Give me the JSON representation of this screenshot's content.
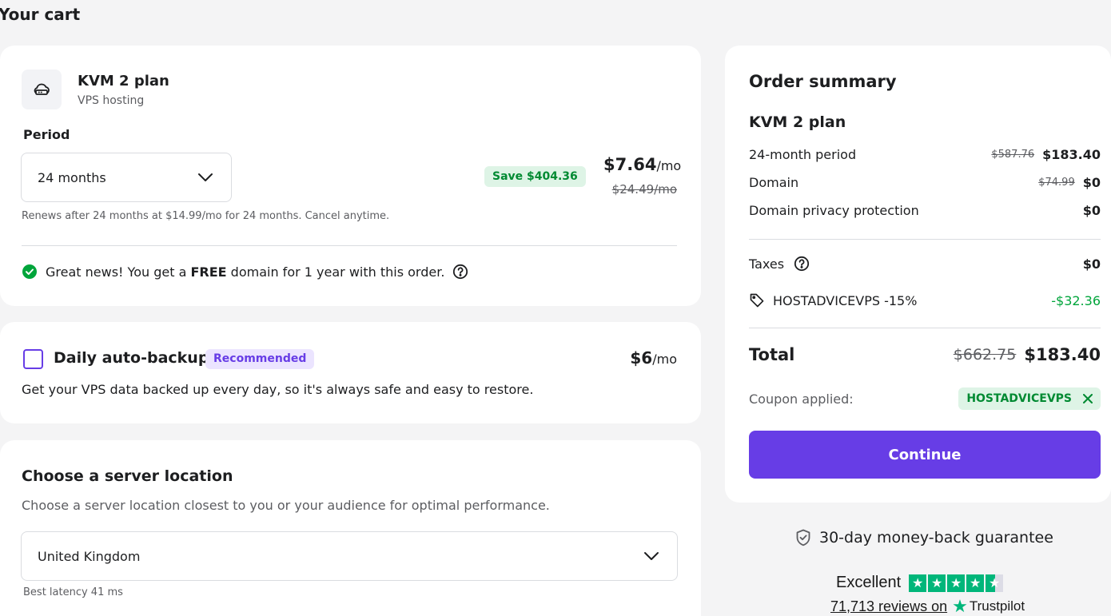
{
  "page": {
    "title": "Your cart"
  },
  "plan": {
    "name": "KVM 2 plan",
    "type": "VPS hosting",
    "icon": "vps-cloud-icon",
    "period_label": "Period",
    "period_value": "24 months",
    "save_badge": "Save $404.36",
    "price": "$7.64",
    "price_unit": "/mo",
    "old_price": "$24.49/mo",
    "renew_note": "Renews after 24 months at $14.99/mo for 24 months. Cancel anytime.",
    "promo_prefix": "Great news! You get a",
    "promo_bold": "FREE",
    "promo_suffix": "domain for 1 year with this order."
  },
  "backup": {
    "title": "Daily auto-backup",
    "badge": "Recommended",
    "price": "$6",
    "price_unit": "/mo",
    "description": "Get your VPS data backed up every day, so it's always safe and easy to restore.",
    "checked": false
  },
  "location": {
    "title": "Choose a server location",
    "description": "Choose a server location closest to you or your audience for optimal performance.",
    "value": "United Kingdom",
    "latency": "Best latency 41 ms"
  },
  "summary": {
    "title": "Order summary",
    "plan": "KVM 2 plan",
    "rows": [
      {
        "label": "24-month period",
        "old": "$587.76",
        "value": "$183.40"
      },
      {
        "label": "Domain",
        "old": "$74.99",
        "value": "$0"
      },
      {
        "label": "Domain privacy protection",
        "old": "",
        "value": "$0"
      }
    ],
    "taxes_label": "Taxes",
    "taxes_value": "$0",
    "discount_code": "HOSTADVICEVPS -15%",
    "discount_value": "-$32.36",
    "total_label": "Total",
    "total_old": "$662.75",
    "total_value": "$183.40",
    "coupon_label": "Coupon applied:",
    "coupon_code": "HOSTADVICEVPS",
    "continue_label": "Continue"
  },
  "guarantee": "30-day money-back guarantee",
  "trustpilot": {
    "rating_word": "Excellent",
    "stars": 4.5,
    "reviews_text": "71,713 reviews on",
    "brand": "Trustpilot"
  },
  "colors": {
    "accent": "#673de6",
    "success": "#00a53b",
    "trustpilot": "#00b67a"
  }
}
